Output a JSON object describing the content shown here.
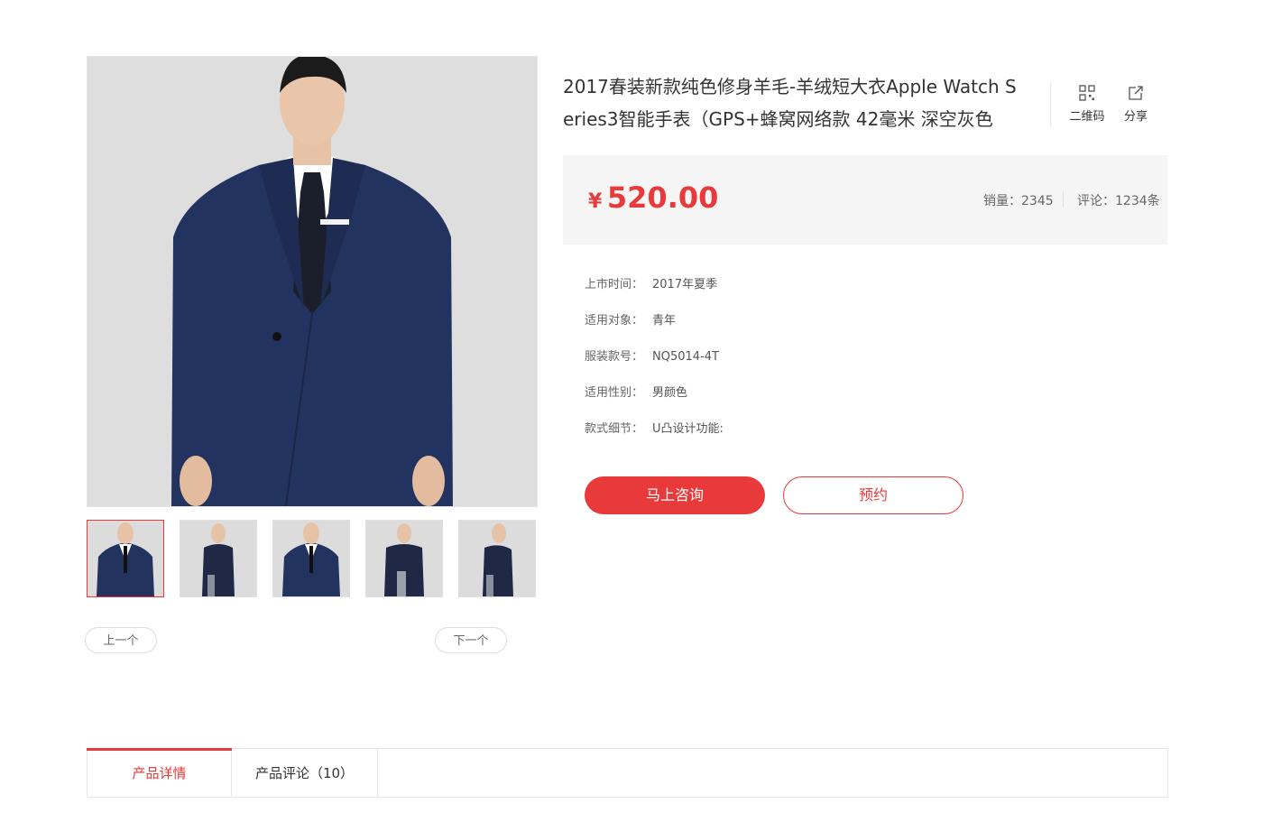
{
  "product": {
    "title": "2017春装新款纯色修身羊毛-羊绒短大衣Apple Watch Series3智能手表（GPS+蜂窝网络款 42毫米 深空灰色"
  },
  "tools": {
    "qrcode_label": "二维码",
    "share_label": "分享"
  },
  "price": {
    "currency": "¥",
    "value": "520.00",
    "sales": "销量：2345",
    "comments": "评论：1234条"
  },
  "attributes": [
    {
      "label": "上市时间：",
      "value": "2017年夏季"
    },
    {
      "label": "适用对象：",
      "value": "青年"
    },
    {
      "label": "服装款号：",
      "value": "NQ5014-4T"
    },
    {
      "label": "适用性别：",
      "value": "男颜色"
    },
    {
      "label": "款式细节：",
      "value": "U凸设计功能:"
    }
  ],
  "actions": {
    "consult": "马上咨询",
    "reserve": "预约"
  },
  "gallery": {
    "prev": "上一个",
    "next": "下一个"
  },
  "tabs": [
    {
      "label": "产品详情"
    },
    {
      "label": "产品评论（10）"
    }
  ],
  "colors": {
    "accent": "#e83a3a",
    "suit": "#22315f",
    "background_photo": "#dcdcdc"
  }
}
